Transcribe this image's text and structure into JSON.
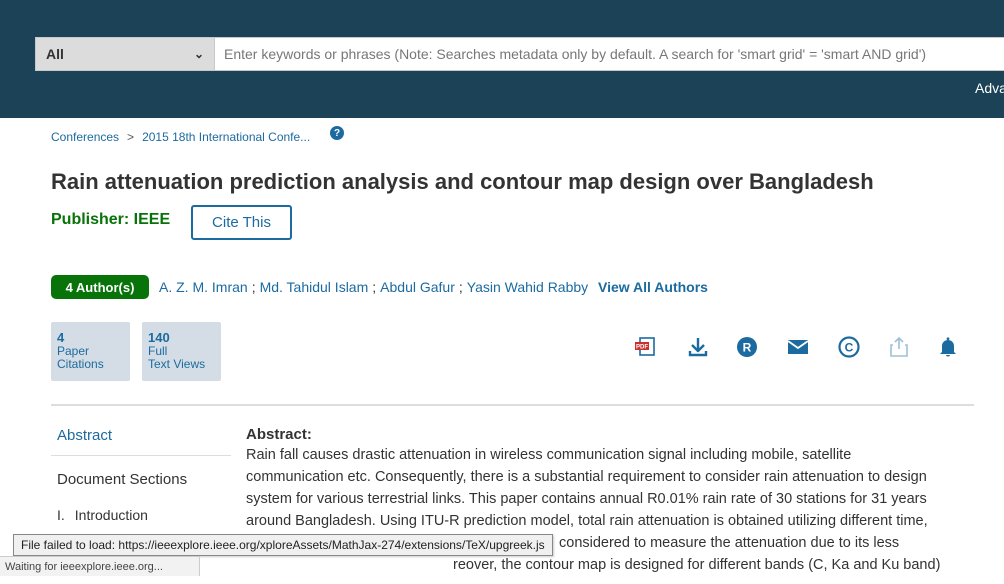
{
  "search": {
    "scope": "All",
    "placeholder": "Enter keywords or phrases (Note: Searches metadata only by default. A search for 'smart grid' = 'smart AND grid')",
    "advanced_label": "Adva"
  },
  "breadcrumb": {
    "items": [
      "Conferences",
      "2015 18th International Confe..."
    ],
    "separator": ">"
  },
  "paper": {
    "title": "Rain attenuation prediction analysis and contour map design over Bangladesh",
    "publisher": "Publisher: IEEE",
    "cite_label": "Cite This",
    "authors_badge": "4 Author(s)",
    "authors": [
      "A. Z. M. Imran",
      "Md. Tahidul Islam",
      "Abdul Gafur",
      "Yasin Wahid Rabby"
    ],
    "view_all_authors": "View All Authors"
  },
  "metrics": [
    {
      "value": "4",
      "line1": "Paper",
      "line2": "Citations"
    },
    {
      "value": "140",
      "line1": "Full",
      "line2": "Text Views"
    }
  ],
  "toolbar_icons": [
    "pdf-icon",
    "download-icon",
    "rights-icon",
    "email-icon",
    "copyright-icon",
    "share-icon",
    "alert-bell-icon"
  ],
  "sidebar": {
    "abstract": "Abstract",
    "document_sections": "Document Sections",
    "intro_num": "I.",
    "intro_label": "Introduction"
  },
  "abstract": {
    "heading": "Abstract:",
    "lines": [
      "Rain fall causes drastic attenuation in wireless communication signal including mobile, satellite",
      "communication etc. Consequently, there is a substantial requirement to consider rain attenuation to design",
      "system for various terrestrial links. This paper contains annual R0.01% rain rate of 30 stations for 31 years",
      "around Bangladesh. Using ITU-R prediction model, total rain attenuation is obtained utilizing different time,",
      "considered to measure the attenuation due to its less",
      "reover, the contour map is designed for different bands (C, Ka and Ku band)"
    ]
  },
  "browser": {
    "tooltip": "File failed to load: https://ieeexplore.ieee.org/xploreAssets/MathJax-274/extensions/TeX/upgreek.js",
    "status": "Waiting for ieeexplore.ieee.org..."
  },
  "colors": {
    "header_bg": "#1c4257",
    "link": "#1c6ba0",
    "publisher_green": "#087308",
    "metric_bg": "#d4dde5"
  }
}
